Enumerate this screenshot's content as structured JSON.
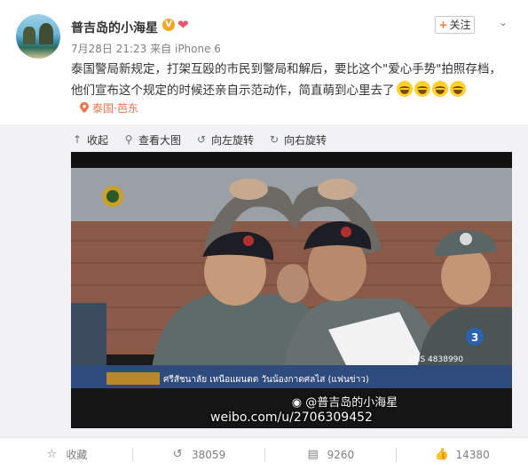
{
  "post": {
    "username": "普吉岛的小海星",
    "vbadge": "V",
    "follow_label": "关注",
    "follow_plus": "+",
    "date": "7月28日 21:23",
    "source_prefix": "来自",
    "source": "iPhone 6",
    "text_line1": "泰国警局新规定，打架互殴的市民到警局和解后，要比这个\"爱心手势\"拍照存档，",
    "text_line2": "他们宣布这个规定的时候还亲自示范动作，简直萌到心里去了",
    "emoji_count": 4,
    "location": "泰国·芭东"
  },
  "toolbar": {
    "collapse": "收起",
    "view_large": "查看大图",
    "rotate_left": "向左旋转",
    "rotate_right": "向右旋转"
  },
  "photo": {
    "ticker_text": "ศรีสัชนาลัย เหนือแผนดต วันน้องกาดศลไส (แฟนข่าว)",
    "sms_text": "SMS 4838990",
    "watermark_handle": "@普吉岛的小海星",
    "watermark_url": "weibo.com/u/2706309452",
    "channel": "3"
  },
  "actions": {
    "favorite": "收藏",
    "repost_count": "38059",
    "comment_count": "9260",
    "like_count": "14380"
  },
  "colors": {
    "accent_orange": "#eb7350",
    "link_gray": "#808080",
    "badge_gold": "#f5a623"
  }
}
